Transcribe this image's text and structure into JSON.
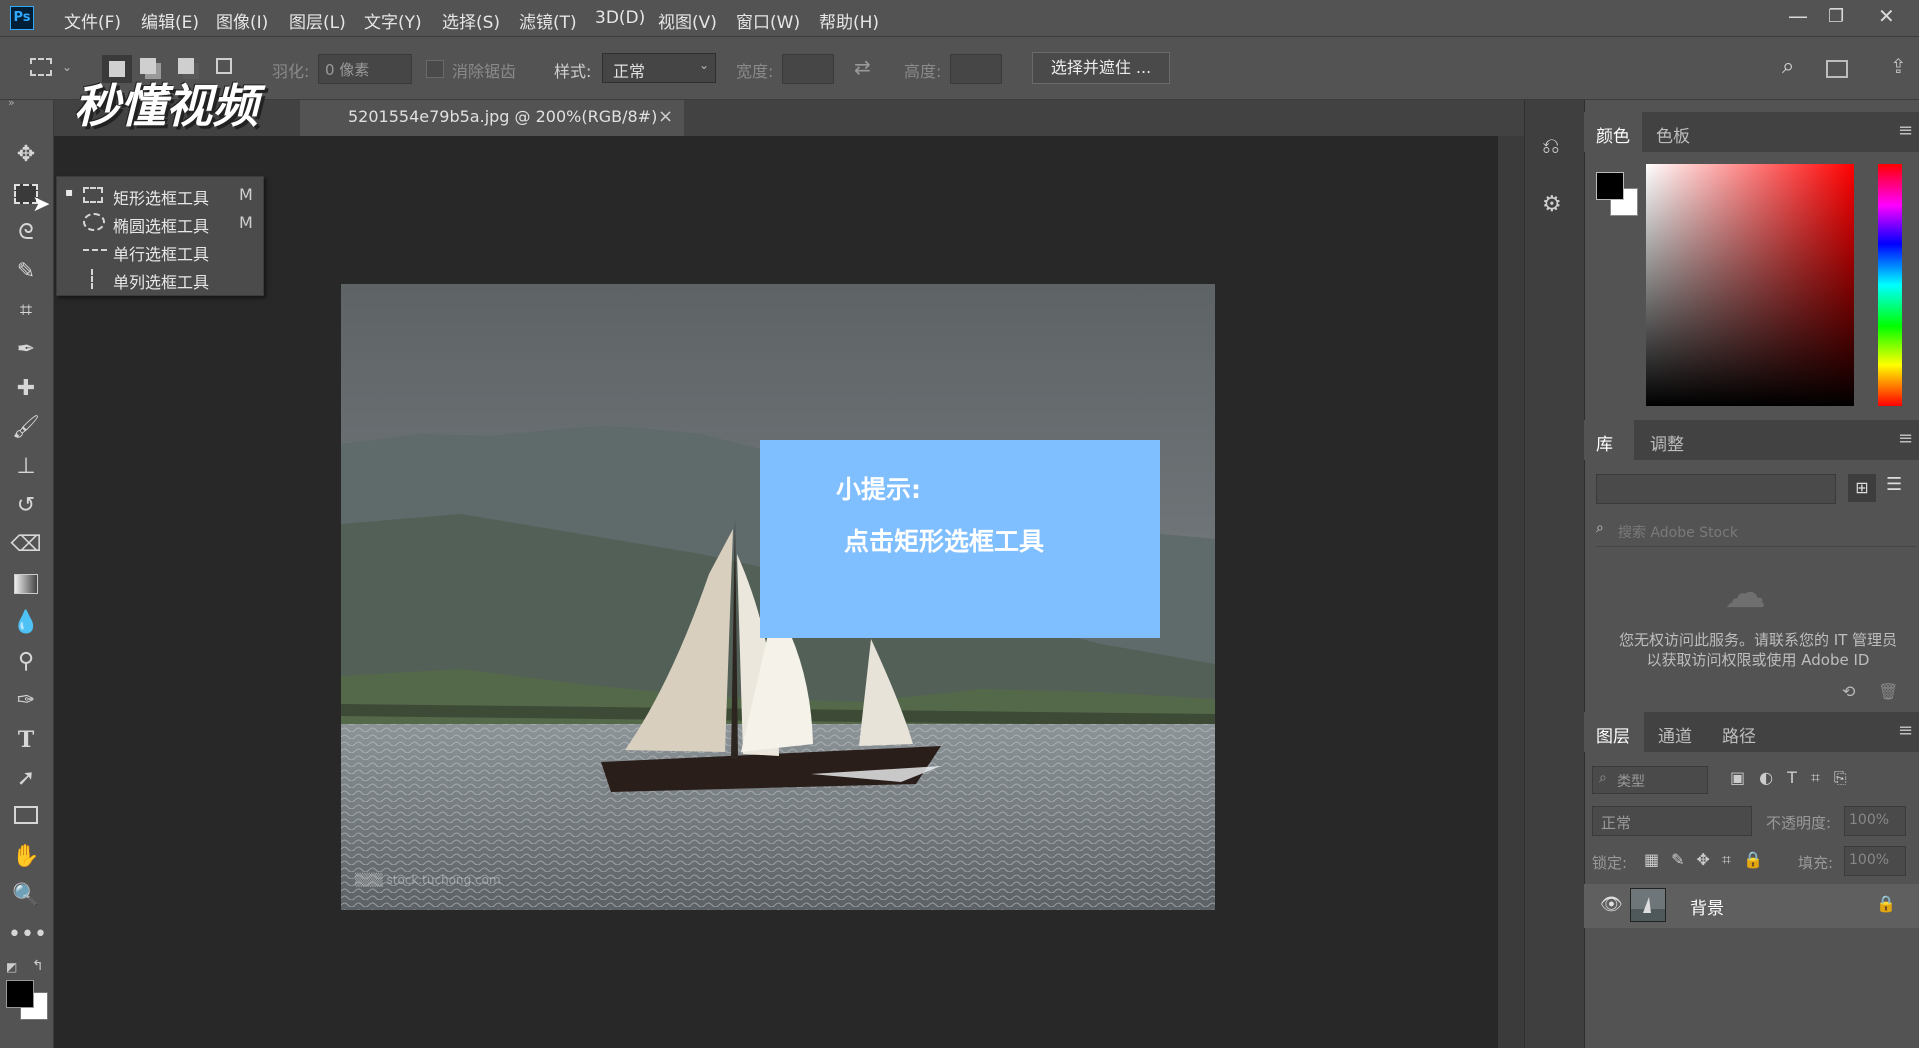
{
  "app": {
    "logo_text": "Ps"
  },
  "menu": [
    "文件(F)",
    "编辑(E)",
    "图像(I)",
    "图层(L)",
    "文字(Y)",
    "选择(S)",
    "滤镜(T)",
    "3D(D)",
    "视图(V)",
    "窗口(W)",
    "帮助(H)"
  ],
  "window_controls": {
    "minimize": "—",
    "restore": "❐",
    "close": "✕"
  },
  "options_bar": {
    "feather_label": "羽化:",
    "feather_value": "0 像素",
    "antialias_label": "消除锯齿",
    "style_label": "样式:",
    "style_value": "正常",
    "width_label": "宽度:",
    "height_label": "高度:",
    "select_mask_button": "选择并遮住 ..."
  },
  "watermark": {
    "text": "秒懂视频"
  },
  "document_tab": {
    "title": "5201554e79b5a.jpg @ 200%(RGB/8#)",
    "close": "×"
  },
  "flyout": {
    "items": [
      {
        "label": "矩形选框工具",
        "key": "M",
        "icon": "rect-marquee-icon",
        "active": true
      },
      {
        "label": "椭圆选框工具",
        "key": "M",
        "icon": "ellipse-marquee-icon",
        "active": false
      },
      {
        "label": "单行选框工具",
        "key": "",
        "icon": "single-row-marquee-icon",
        "active": false
      },
      {
        "label": "单列选框工具",
        "key": "",
        "icon": "single-column-marquee-icon",
        "active": false
      }
    ]
  },
  "tip": {
    "line1": "小提示:",
    "line2": "点击矩形选框工具"
  },
  "tip_colors": {
    "box": "#80bfff",
    "text": "#ffffff"
  },
  "color_panel": {
    "tabs": [
      "颜色",
      "色板"
    ],
    "foreground": "#000000",
    "background": "#ffffff"
  },
  "library_panel": {
    "tabs": [
      "库",
      "调整"
    ],
    "search_placeholder": "搜索 Adobe Stock",
    "message": "您无权访问此服务。请联系您的 IT 管理员以获取访问权限或使用 Adobe ID"
  },
  "layers_panel": {
    "tabs": [
      "图层",
      "通道",
      "路径"
    ],
    "filter_label": "类型",
    "blend_mode": "正常",
    "opacity_label": "不透明度:",
    "opacity_value": "100%",
    "lock_label": "锁定:",
    "fill_label": "填充:",
    "fill_value": "100%",
    "layers": [
      {
        "name": "背景",
        "visible": true,
        "locked": true
      }
    ]
  }
}
